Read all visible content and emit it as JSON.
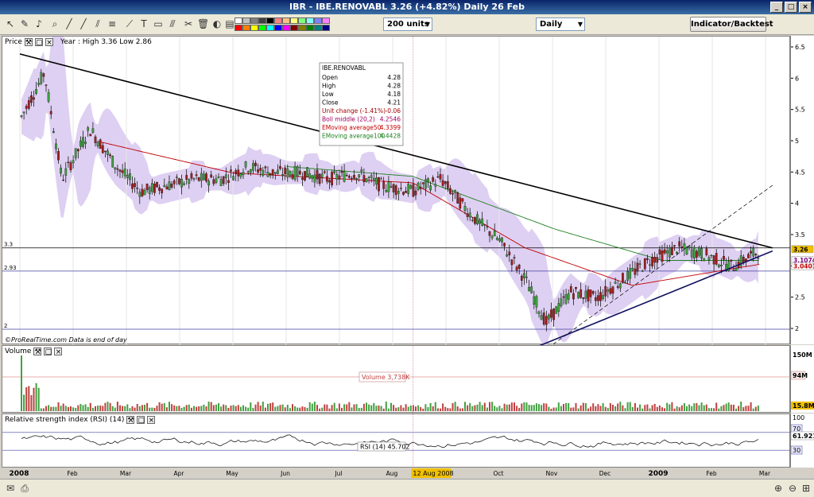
{
  "window": {
    "title": "IBR - IBE.RENOVABL   3.26 (+4.82%)   Daily  26 Feb"
  },
  "toolbar": {
    "units_select": "200 units",
    "period_select": "Daily",
    "indicator_button": "Indicator/Backtest",
    "swatch_colors": [
      "#ffffff",
      "#c0c0c0",
      "#808080",
      "#404040",
      "#000000",
      "#ff8080",
      "#ffc080",
      "#ffff80",
      "#80ff80",
      "#80ffff",
      "#8080ff",
      "#ff80ff",
      "#ff0000",
      "#ff8000",
      "#ffff00",
      "#00ff00",
      "#00ffff",
      "#0000ff",
      "#ff00ff",
      "#800000",
      "#808000",
      "#008000",
      "#008080",
      "#000080"
    ]
  },
  "price_panel": {
    "title": "Price",
    "year_info": "Year : High 3.36 Low 2.86",
    "credit": "©ProRealTime.com  Data is end of day",
    "level_labels": [
      "3.3",
      "2.93",
      "2"
    ],
    "right_ticks": [
      "6.5",
      "6",
      "5.5",
      "5",
      "4.5",
      "4",
      "3.5",
      "3",
      "2.5",
      "2"
    ],
    "value_badges": {
      "last": "3.26",
      "boll": "3.1074",
      "ema": "3.0401"
    }
  },
  "tooltip": {
    "symbol": "IBE.RENOVABL",
    "rows": [
      {
        "label": "Open",
        "value": "4.28"
      },
      {
        "label": "High",
        "value": "4.28"
      },
      {
        "label": "Low",
        "value": "4.18"
      },
      {
        "label": "Close",
        "value": "4.21"
      },
      {
        "label": "Unit change (-1.41%)",
        "value": "-0.06"
      },
      {
        "label": "Boll middle (20,2)",
        "value": "4.2546"
      },
      {
        "label": "EMoving average50",
        "value": "4.3399"
      },
      {
        "label": "EMoving average100",
        "value": "4.4428"
      }
    ]
  },
  "volume_panel": {
    "title": "Volume",
    "label": "Volume 3,738K",
    "right_ticks": [
      "150M",
      "94M",
      "15.8M"
    ]
  },
  "rsi_panel": {
    "title": "Relative strength index (RSI) (14)",
    "label": "RSI (14) 45.702",
    "right_ticks": [
      "100",
      "70",
      "61.921",
      "30"
    ]
  },
  "x_axis": {
    "labels": [
      "2008",
      "Feb",
      "Mar",
      "Apr",
      "May",
      "Jun",
      "Jul",
      "Aug",
      "Sep",
      "Oct",
      "Nov",
      "Dec",
      "2009",
      "Feb",
      "Mar"
    ],
    "cursor_date": "12 Aug 2008"
  },
  "chart_data": {
    "type": "candlestick",
    "title": "IBR - IBE.RENOVABL",
    "ylim": [
      2,
      6.5
    ],
    "x_range": [
      "2008-01",
      "2009-03"
    ],
    "close_series_approx": [
      {
        "date": "2008-01-02",
        "close": 5.4
      },
      {
        "date": "2008-01-15",
        "close": 6.1
      },
      {
        "date": "2008-01-25",
        "close": 4.4
      },
      {
        "date": "2008-02-10",
        "close": 5.2
      },
      {
        "date": "2008-02-25",
        "close": 4.6
      },
      {
        "date": "2008-03-10",
        "close": 4.2
      },
      {
        "date": "2008-03-25",
        "close": 4.3
      },
      {
        "date": "2008-04-10",
        "close": 4.4
      },
      {
        "date": "2008-04-25",
        "close": 4.4
      },
      {
        "date": "2008-05-10",
        "close": 4.6
      },
      {
        "date": "2008-05-25",
        "close": 4.5
      },
      {
        "date": "2008-06-10",
        "close": 4.5
      },
      {
        "date": "2008-06-25",
        "close": 4.4
      },
      {
        "date": "2008-07-10",
        "close": 4.5
      },
      {
        "date": "2008-07-25",
        "close": 4.3
      },
      {
        "date": "2008-08-12",
        "close": 4.21
      },
      {
        "date": "2008-08-28",
        "close": 4.4
      },
      {
        "date": "2008-09-15",
        "close": 3.8
      },
      {
        "date": "2008-10-01",
        "close": 3.4
      },
      {
        "date": "2008-10-15",
        "close": 2.8
      },
      {
        "date": "2008-10-27",
        "close": 2.1
      },
      {
        "date": "2008-11-10",
        "close": 2.6
      },
      {
        "date": "2008-11-25",
        "close": 2.5
      },
      {
        "date": "2008-12-10",
        "close": 2.8
      },
      {
        "date": "2008-12-25",
        "close": 3.1
      },
      {
        "date": "2009-01-10",
        "close": 3.3
      },
      {
        "date": "2009-01-25",
        "close": 3.2
      },
      {
        "date": "2009-02-10",
        "close": 3.0
      },
      {
        "date": "2009-02-26",
        "close": 3.26
      }
    ],
    "ema50_approx": [
      {
        "date": "2008-02-15",
        "value": 5.0
      },
      {
        "date": "2008-05-01",
        "value": 4.5
      },
      {
        "date": "2008-08-12",
        "value": 4.3399
      },
      {
        "date": "2008-10-15",
        "value": 3.3
      },
      {
        "date": "2008-12-15",
        "value": 2.7
      },
      {
        "date": "2009-02-26",
        "value": 3.04
      }
    ],
    "ema100_approx": [
      {
        "date": "2008-06-01",
        "value": 4.6
      },
      {
        "date": "2008-08-12",
        "value": 4.4428
      },
      {
        "date": "2008-11-01",
        "value": 3.6
      },
      {
        "date": "2009-01-01",
        "value": 3.1
      },
      {
        "date": "2009-02-26",
        "value": 3.1
      }
    ],
    "horizontal_levels": [
      3.3,
      2.93,
      2
    ],
    "trendlines": [
      {
        "name": "resistance",
        "from": {
          "date": "2008-01-01",
          "value": 6.4
        },
        "to": {
          "date": "2009-03-05",
          "value": 3.3
        }
      },
      {
        "name": "support",
        "from": {
          "date": "2008-10-20",
          "value": 1.7
        },
        "to": {
          "date": "2009-03-05",
          "value": 3.25
        }
      }
    ],
    "rsi_levels": [
      30,
      70
    ],
    "rsi_last": 45.702
  }
}
